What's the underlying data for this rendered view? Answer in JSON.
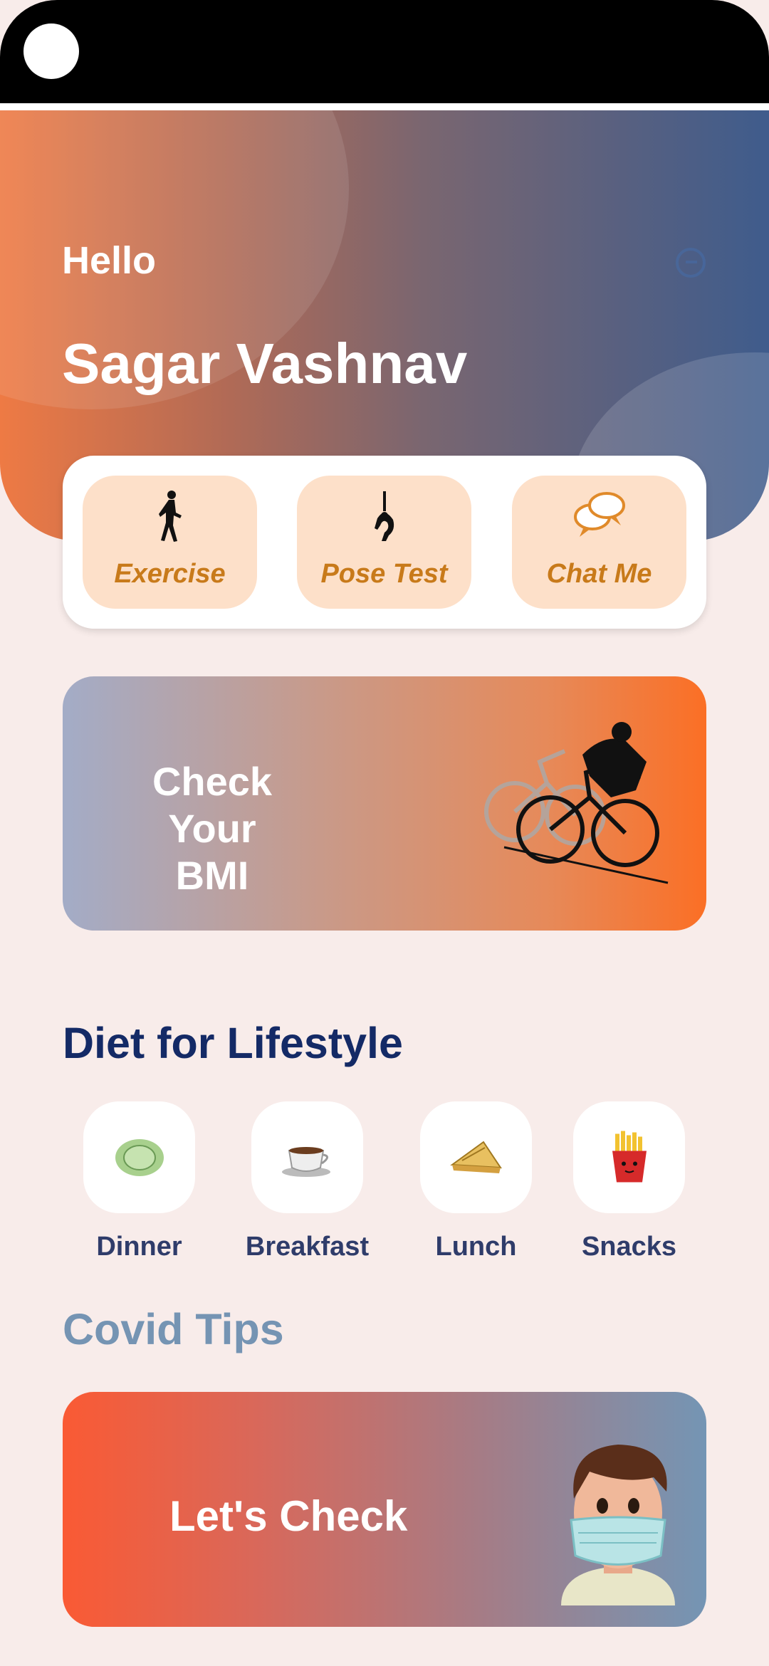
{
  "header": {
    "greeting": "Hello",
    "user_name": "Sagar Vashnav"
  },
  "quick_actions": [
    {
      "label": "Exercise",
      "icon": "running-person-icon"
    },
    {
      "label": "Pose Test",
      "icon": "yoga-pose-icon"
    },
    {
      "label": "Chat Me",
      "icon": "chat-bubbles-icon"
    }
  ],
  "bmi_card": {
    "line1": "Check Your",
    "line2": "BMI",
    "icon": "cyclist-illustration"
  },
  "diet": {
    "title": "Diet for Lifestyle",
    "items": [
      {
        "label": "Dinner",
        "icon": "dinner-plate-icon"
      },
      {
        "label": "Breakfast",
        "icon": "tea-cup-icon"
      },
      {
        "label": "Lunch",
        "icon": "sandwich-icon"
      },
      {
        "label": "Snacks",
        "icon": "fries-icon"
      }
    ]
  },
  "covid": {
    "title": "Covid Tips",
    "card_label": "Let's Check",
    "icon": "masked-person-illustration"
  },
  "colors": {
    "header_start": "#ee7a44",
    "header_end": "#3f5c8c",
    "quick_button_bg": "#fde0c9",
    "quick_label": "#c87a1a",
    "diet_title": "#142a66",
    "covid_title": "#7594b3",
    "page_bg": "#f8ecea"
  }
}
